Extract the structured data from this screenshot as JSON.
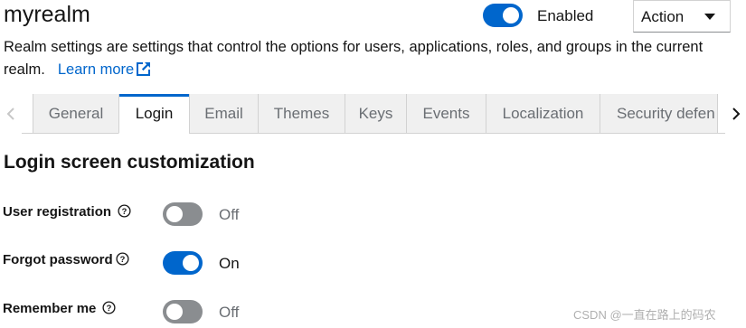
{
  "header": {
    "title": "myrealm",
    "enabled_label": "Enabled",
    "enabled": true,
    "action_label": "Action"
  },
  "description": {
    "text": "Realm settings are settings that control the options for users, applications, roles, and groups in the current realm.",
    "learn_more": "Learn more"
  },
  "tabs": [
    {
      "label": "General",
      "active": false
    },
    {
      "label": "Login",
      "active": true
    },
    {
      "label": "Email",
      "active": false
    },
    {
      "label": "Themes",
      "active": false
    },
    {
      "label": "Keys",
      "active": false
    },
    {
      "label": "Events",
      "active": false
    },
    {
      "label": "Localization",
      "active": false
    },
    {
      "label": "Security defen",
      "active": false
    }
  ],
  "section": {
    "title": "Login screen customization"
  },
  "settings": [
    {
      "label": "User registration",
      "value": false,
      "state_text": "Off"
    },
    {
      "label": "Forgot password",
      "value": true,
      "state_text": "On"
    },
    {
      "label": "Remember me",
      "value": false,
      "state_text": "Off"
    }
  ],
  "watermark": "CSDN @一直在路上的码农",
  "colors": {
    "accent": "#0066cc",
    "switch_off": "#8a8d90",
    "tab_inactive_bg": "#f0f0f0",
    "text": "#151515",
    "muted": "#6a6e73"
  }
}
